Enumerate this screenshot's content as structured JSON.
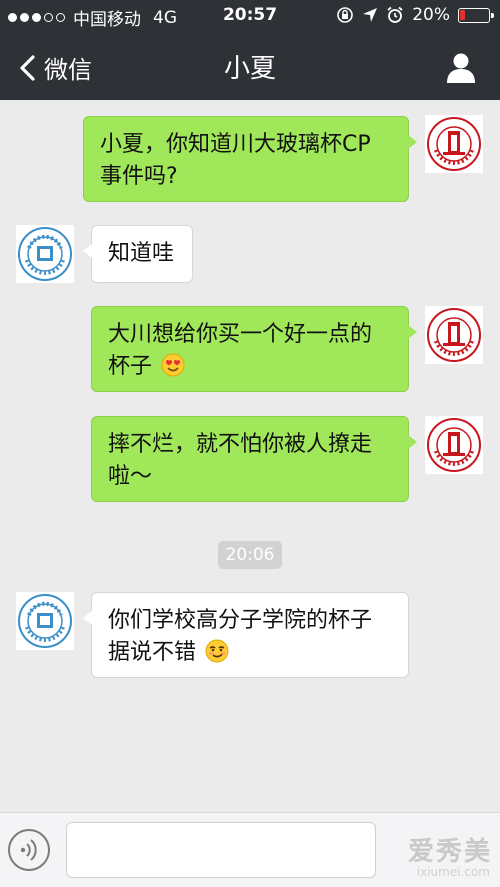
{
  "status_bar": {
    "carrier": "中国移动",
    "network": "4G",
    "time": "20:57",
    "battery_text": "20%",
    "battery_level": 0.2,
    "battery_color": "#e0332b",
    "signal_bars_filled": 3,
    "signal_bars_total": 5,
    "icons": [
      "rotation-lock-icon",
      "location-icon",
      "alarm-icon"
    ]
  },
  "nav": {
    "back_label": "微信",
    "title": "小夏",
    "profile_icon": "person-icon"
  },
  "messages": [
    {
      "side": "right",
      "text": "小夏，你知道川大玻璃杯CP事件吗?",
      "lines": [
        "小夏，你知道川大玻璃杯CP",
        "事件吗?"
      ],
      "avatar": "sichuan-university-logo"
    },
    {
      "side": "left",
      "text": "知道哇",
      "lines": [
        "知道哇"
      ],
      "avatar": "xiamen-university-logo"
    },
    {
      "side": "right",
      "text": "大川想给你买一个好一点的杯子",
      "lines": [
        "大川想给你买一个好一点的",
        "杯子"
      ],
      "emoji": "heart-eyes-emoji",
      "avatar": "sichuan-university-logo"
    },
    {
      "side": "right",
      "text": "摔不烂，就不怕你被人撩走啦～",
      "lines": [
        "摔不烂，就不怕你被人撩走",
        "啦～"
      ],
      "avatar": "sichuan-university-logo"
    },
    {
      "side": "left",
      "text": "你们学校高分子学院的杯子据说不错",
      "lines": [
        "你们学校高分子学院的杯子",
        "据说不错"
      ],
      "emoji": "smirk-emoji",
      "avatar": "xiamen-university-logo"
    }
  ],
  "timestamp": "20:06",
  "input_bar": {
    "voice_icon": "voice-icon",
    "text_value": ""
  },
  "watermark": {
    "text": "爱秀美",
    "sub": "ixiumei.com"
  },
  "colors": {
    "nav_bg": "#2e3135",
    "chat_bg": "#ebebeb",
    "bubble_sent": "#a0e75a",
    "bubble_received": "#ffffff",
    "sichuan_red": "#c8161d",
    "xiamen_blue": "#3a8fc9"
  }
}
